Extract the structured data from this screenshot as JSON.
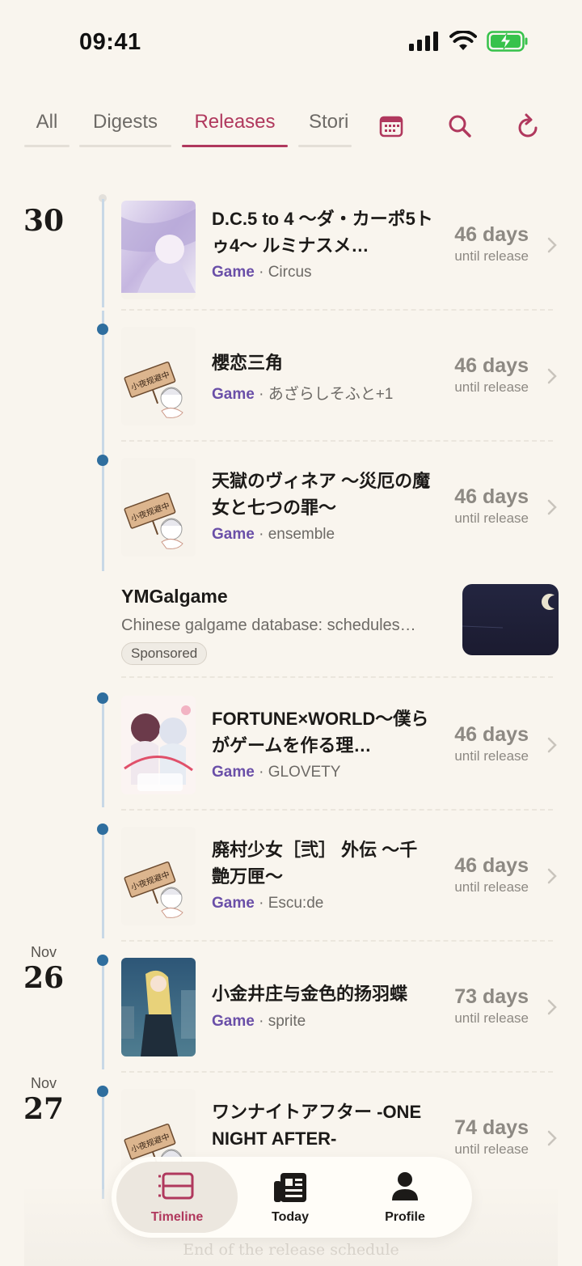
{
  "status": {
    "time": "09:41"
  },
  "tabs": [
    {
      "label": "All",
      "active": false
    },
    {
      "label": "Digests",
      "active": false
    },
    {
      "label": "Releases",
      "active": true
    },
    {
      "label": "Stori",
      "active": false
    }
  ],
  "tab_icons": [
    "calendar-icon",
    "search-icon",
    "refresh-icon"
  ],
  "colors": {
    "accent": "#b0385d",
    "timeline_dot": "#2f6e9e",
    "type": "#6a4fa8",
    "background": "#f9f5ee"
  },
  "dates": [
    {
      "month": "",
      "day": "30"
    },
    {
      "month": "Nov",
      "day": "26"
    },
    {
      "month": "Nov",
      "day": "27"
    }
  ],
  "releases": [
    {
      "title": "D.C.5 to 4 ～ダ・カーポ5トゥ4～ ルミナスメ…",
      "type": "Game",
      "studio": " · Circus",
      "days": "46 days",
      "until": "until release"
    },
    {
      "title": "櫻恋三角",
      "type": "Game",
      "studio": " · あざらしそふと+1",
      "days": "46 days",
      "until": "until release"
    },
    {
      "title": "天獄のヴィネア ～災厄の魔女と七つの罪～",
      "type": "Game",
      "studio": " · ensemble",
      "days": "46 days",
      "until": "until release"
    },
    {
      "title": "FORTUNE×WORLD～僕らがゲームを作る理…",
      "type": "Game",
      "studio": " · GLOVETY",
      "days": "46 days",
      "until": "until release"
    },
    {
      "title": "廃村少女［弐］ 外伝 ～千艶万匣～",
      "type": "Game",
      "studio": " · Escu:de",
      "days": "46 days",
      "until": "until release"
    },
    {
      "title": "小金井庄与金色的扬羽蝶",
      "type": "Game",
      "studio": " · sprite",
      "days": "73 days",
      "until": "until release"
    },
    {
      "title": "ワンナイトアフター -ONE NIGHT AFTER-",
      "type": "",
      "studio": "",
      "days": "74 days",
      "until": "until release"
    }
  ],
  "placeholder_sign": "小夜规避中",
  "ad": {
    "title": "YMGalgame",
    "description": "Chinese galgame database: schedules…",
    "badge": "Sponsored"
  },
  "nav": [
    {
      "label": "Timeline",
      "icon": "timeline-icon",
      "active": true
    },
    {
      "label": "Today",
      "icon": "newspaper-icon",
      "active": false
    },
    {
      "label": "Profile",
      "icon": "person-icon",
      "active": false
    }
  ],
  "footer": "End of the release schedule"
}
